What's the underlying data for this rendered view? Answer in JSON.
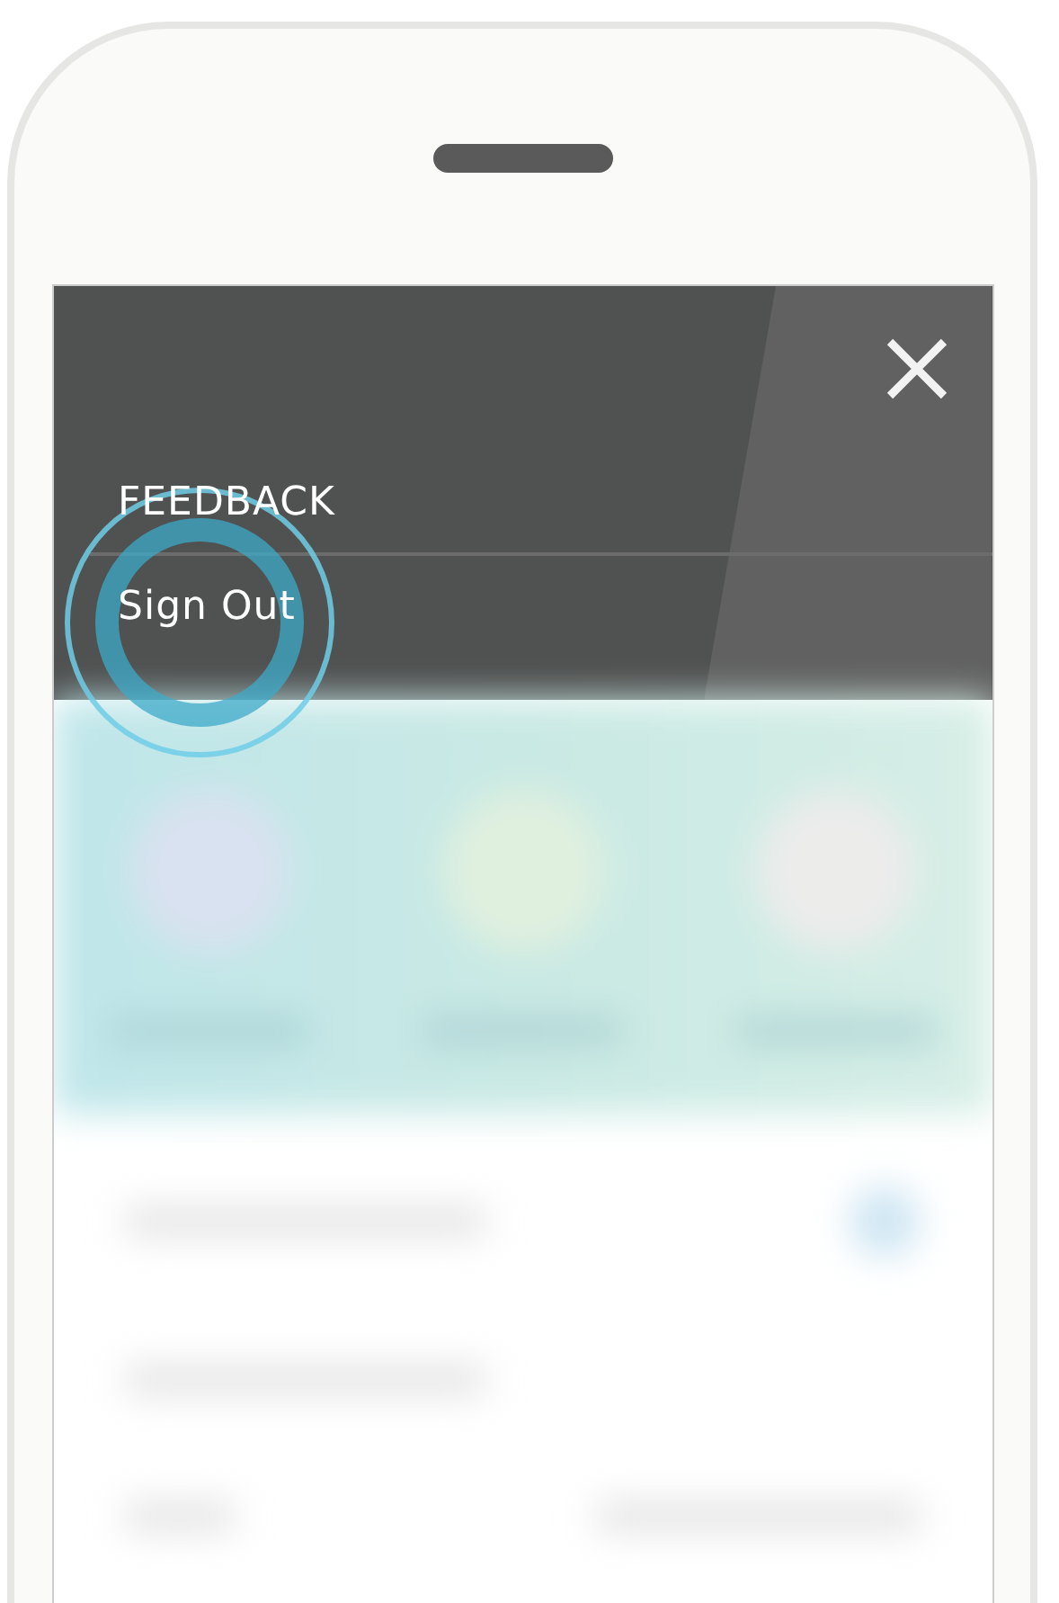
{
  "menu": {
    "items": [
      {
        "label": "FEEDBACK",
        "tapped": false
      },
      {
        "label": "Sign Out",
        "tapped": true
      }
    ]
  }
}
